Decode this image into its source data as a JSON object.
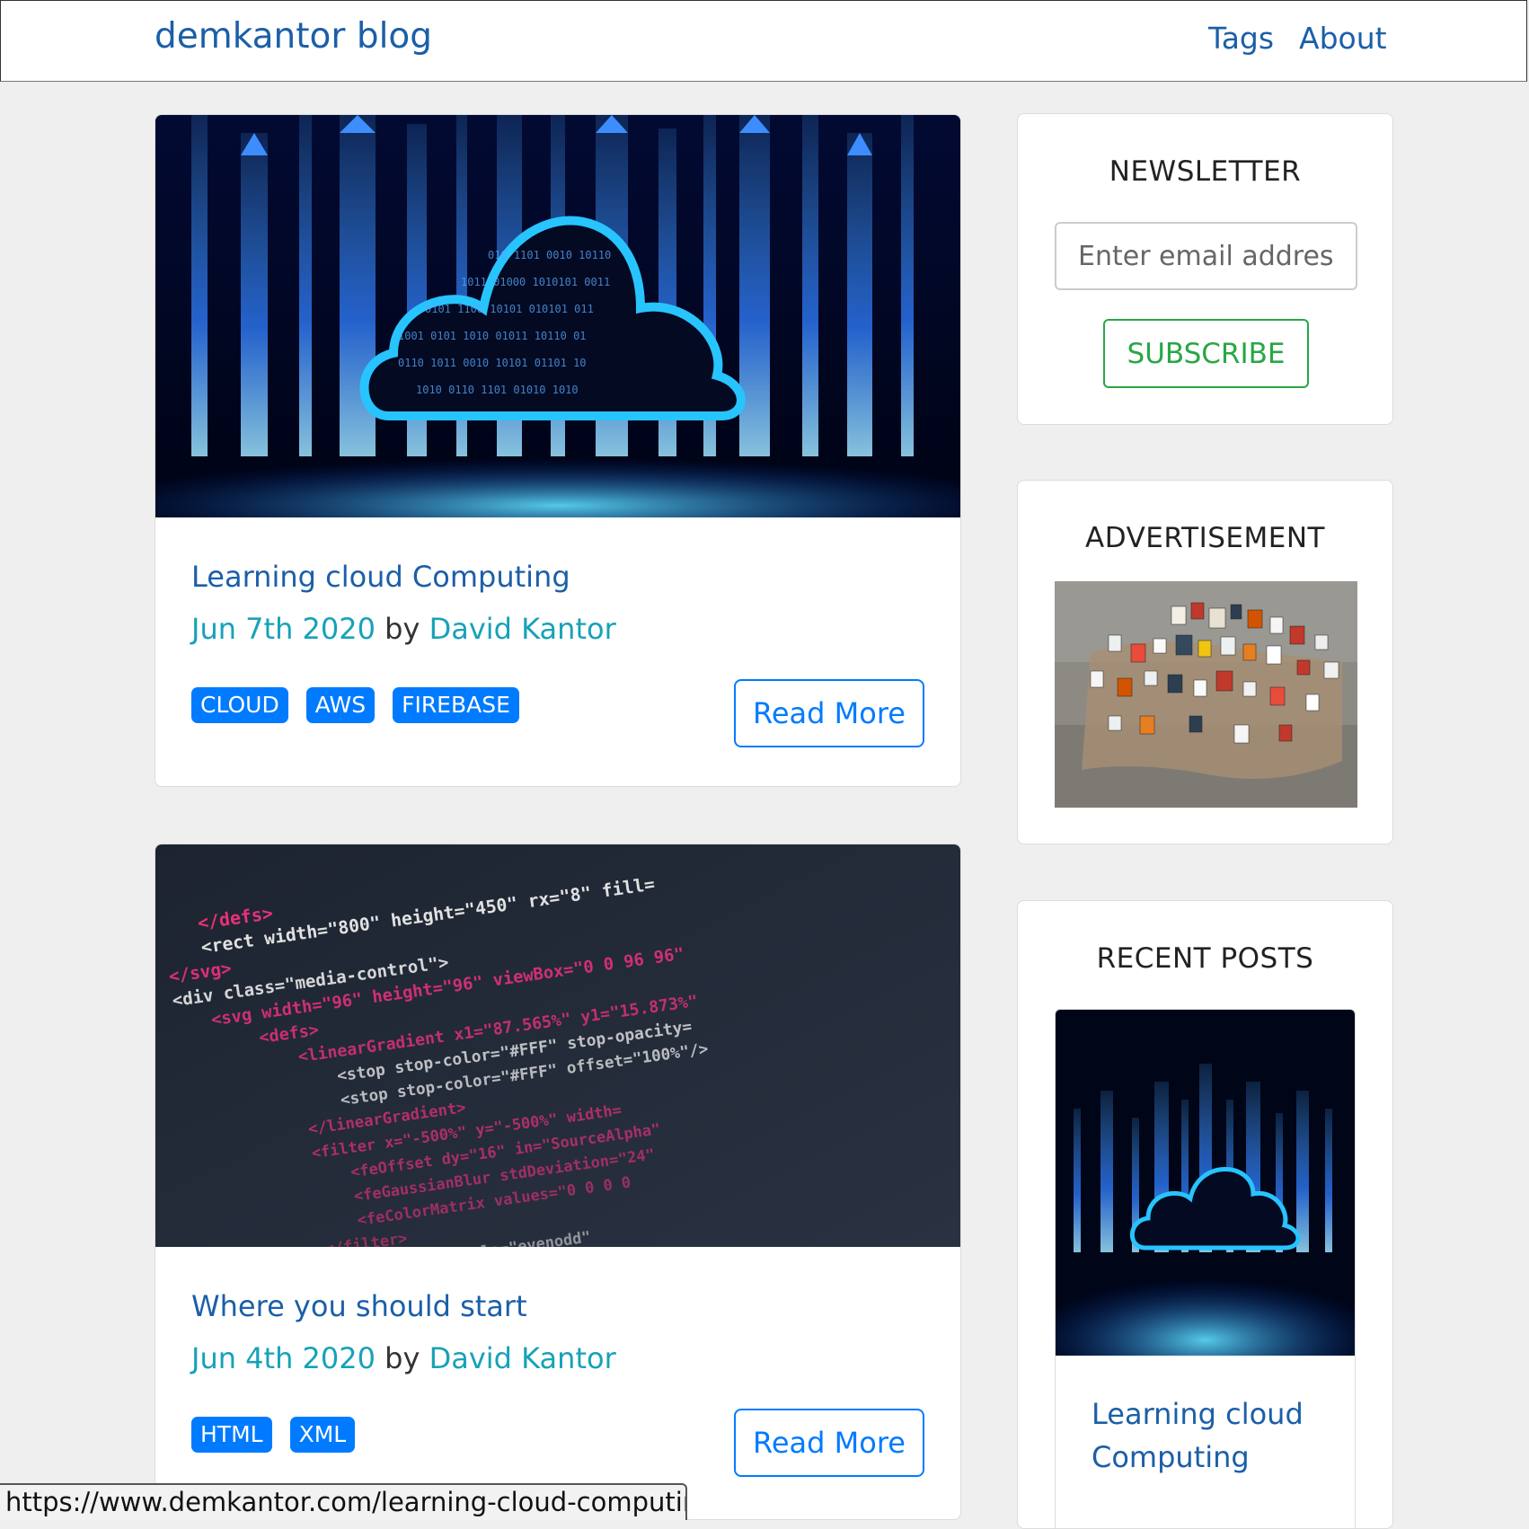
{
  "header": {
    "brand": "demkantor blog",
    "nav": {
      "tags": "Tags",
      "about": "About"
    }
  },
  "posts": [
    {
      "title": "Learning cloud Computing",
      "date": "Jun 7th 2020",
      "by": "by",
      "author": "David Kantor",
      "tags": [
        "CLOUD",
        "AWS",
        "FIREBASE"
      ],
      "read_more": "Read More",
      "image_icon": "cloud-computing-image"
    },
    {
      "title": "Where you should start",
      "date": "Jun 4th 2020",
      "by": "by",
      "author": "David Kantor",
      "tags": [
        "HTML",
        "XML"
      ],
      "read_more": "Read More",
      "image_icon": "code-screen-image",
      "code_lines": [
        "</defs>",
        "<rect width=\"800\" height=\"450\" rx=\"8\" fill=",
        "</svg>",
        "<div class=\"media-control\">",
        "<svg width=\"96\" height=\"96\" viewBox=\"0 0 96 96\"",
        "<defs>",
        "<linearGradient x1=\"87.565%\" y1=\"15.873%\"",
        "<stop stop-color=\"#FFF\" stop-opacity=",
        "<stop stop-color=\"#FFF\" offset=\"100%\"/>",
        "</linearGradient>",
        "<filter x=\"-500%\" y=\"-500%\" width=",
        "<feOffset dy=\"16\" in=\"SourceAlpha\"",
        "<feGaussianBlur stdDeviation=\"24\"",
        "<feColorMatrix values=\"0 0 0 0",
        "</filter>",
        "fill-rule=\"evenodd\""
      ]
    }
  ],
  "sidebar": {
    "newsletter": {
      "title": "NEWSLETTER",
      "email_placeholder": "Enter email address",
      "subscribe_label": "SUBSCRIBE"
    },
    "advertisement": {
      "title": "ADVERTISEMENT",
      "image_icon": "poster-wall-image"
    },
    "recent_posts": {
      "title": "RECENT POSTS",
      "items": [
        {
          "title": "Learning cloud Computing"
        }
      ]
    }
  },
  "status_bar": {
    "url": "https://www.demkantor.com/learning-cloud-computing/"
  },
  "colors": {
    "link": "#1b5fa8",
    "teal": "#17a2b8",
    "primary": "#007bff",
    "success": "#28a745",
    "page_bg": "#efefef"
  }
}
